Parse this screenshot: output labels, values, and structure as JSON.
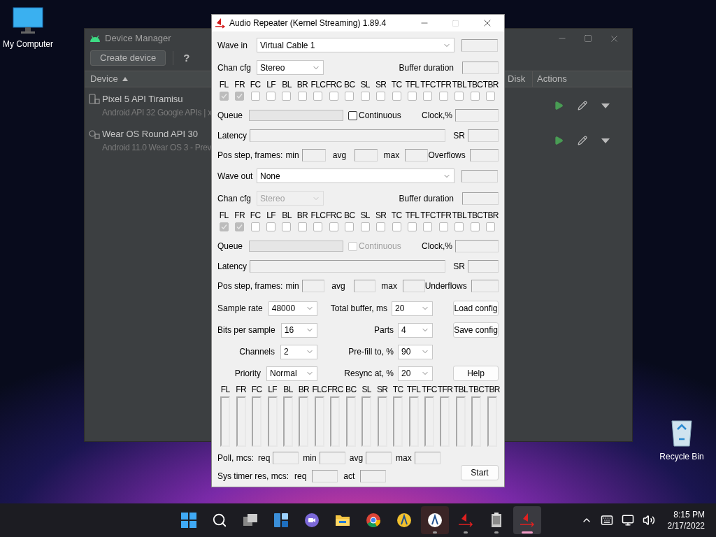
{
  "desktop_icons": [
    {
      "label": "My Computer"
    },
    {
      "label": "Recycle Bin"
    }
  ],
  "device_manager": {
    "title": "Device Manager",
    "create_button": "Create device",
    "help_button": "?",
    "columns": {
      "device": "Device",
      "disk": "Disk",
      "actions": "Actions"
    },
    "devices": [
      {
        "kind": "phone",
        "name": "Pixel 5 API Tiramisu",
        "details": "Android API 32 Google APIs | x"
      },
      {
        "kind": "watch",
        "name": "Wear OS Round API 30",
        "details": "Android 11.0 Wear OS 3 - Prev"
      }
    ]
  },
  "audio_repeater": {
    "title": "Audio Repeater (Kernel Streaming) 1.89.4",
    "sections": [
      {
        "wave_label": "Wave in",
        "device": "Virtual Cable 1",
        "chan_cfg_label": "Chan cfg",
        "chan_cfg": {
          "value": "Stereo",
          "disabled": false
        },
        "buffer_label": "Buffer duration",
        "channels": [
          {
            "label": "FL",
            "checked": true,
            "disabled": true
          },
          {
            "label": "FR",
            "checked": true,
            "disabled": true
          },
          {
            "label": "FC",
            "checked": false,
            "disabled": false
          },
          {
            "label": "LF",
            "checked": false,
            "disabled": false
          },
          {
            "label": "BL",
            "checked": false,
            "disabled": false
          },
          {
            "label": "BR",
            "checked": false,
            "disabled": false
          },
          {
            "label": "FLC",
            "checked": false,
            "disabled": false
          },
          {
            "label": "FRC",
            "checked": false,
            "disabled": false
          },
          {
            "label": "BC",
            "checked": false,
            "disabled": false
          },
          {
            "label": "SL",
            "checked": false,
            "disabled": false
          },
          {
            "label": "SR",
            "checked": false,
            "disabled": false
          },
          {
            "label": "TC",
            "checked": false,
            "disabled": false
          },
          {
            "label": "TFL",
            "checked": false,
            "disabled": false
          },
          {
            "label": "TFC",
            "checked": false,
            "disabled": false
          },
          {
            "label": "TFR",
            "checked": false,
            "disabled": false
          },
          {
            "label": "TBL",
            "checked": false,
            "disabled": false
          },
          {
            "label": "TBC",
            "checked": false,
            "disabled": false
          },
          {
            "label": "TBR",
            "checked": false,
            "disabled": false
          }
        ],
        "queue_label": "Queue",
        "continuous": {
          "label": "Continuous",
          "checked": false,
          "disabled": false
        },
        "clock_label": "Clock,%",
        "latency_label": "Latency",
        "sr_label": "SR",
        "pos_label": "Pos step, frames:",
        "min_label": "min",
        "avg_label": "avg",
        "max_label": "max",
        "flows_label": "Overflows"
      },
      {
        "wave_label": "Wave out",
        "device": "None",
        "chan_cfg_label": "Chan cfg",
        "chan_cfg": {
          "value": "Stereo",
          "disabled": true
        },
        "buffer_label": "Buffer duration",
        "channels": [
          {
            "label": "FL",
            "checked": true,
            "disabled": true
          },
          {
            "label": "FR",
            "checked": true,
            "disabled": true
          },
          {
            "label": "FC",
            "checked": false,
            "disabled": false
          },
          {
            "label": "LF",
            "checked": false,
            "disabled": false
          },
          {
            "label": "BL",
            "checked": false,
            "disabled": false
          },
          {
            "label": "BR",
            "checked": false,
            "disabled": false
          },
          {
            "label": "FLC",
            "checked": false,
            "disabled": false
          },
          {
            "label": "FRC",
            "checked": false,
            "disabled": false
          },
          {
            "label": "BC",
            "checked": false,
            "disabled": false
          },
          {
            "label": "SL",
            "checked": false,
            "disabled": false
          },
          {
            "label": "SR",
            "checked": false,
            "disabled": false
          },
          {
            "label": "TC",
            "checked": false,
            "disabled": false
          },
          {
            "label": "TFL",
            "checked": false,
            "disabled": false
          },
          {
            "label": "TFC",
            "checked": false,
            "disabled": false
          },
          {
            "label": "TFR",
            "checked": false,
            "disabled": false
          },
          {
            "label": "TBL",
            "checked": false,
            "disabled": false
          },
          {
            "label": "TBC",
            "checked": false,
            "disabled": false
          },
          {
            "label": "TBR",
            "checked": false,
            "disabled": false
          }
        ],
        "queue_label": "Queue",
        "continuous": {
          "label": "Continuous",
          "checked": false,
          "disabled": true
        },
        "clock_label": "Clock,%",
        "latency_label": "Latency",
        "sr_label": "SR",
        "pos_label": "Pos step, frames:",
        "min_label": "min",
        "avg_label": "avg",
        "max_label": "max",
        "flows_label": "Underflows"
      }
    ],
    "settings": [
      {
        "label": "Sample rate",
        "value": "48000",
        "label2": "Total buffer, ms",
        "value2": "20",
        "button": "Load config"
      },
      {
        "label": "Bits per sample",
        "value": "16",
        "label2": "Parts",
        "value2": "4",
        "button": "Save config"
      },
      {
        "label": "Channels",
        "value": "2",
        "label2": "Pre-fill to, %",
        "value2": "90"
      },
      {
        "label": "Priority",
        "value": "Normal",
        "label2": "Resync at, %",
        "value2": "20",
        "button": "Help"
      }
    ],
    "meter_labels": [
      "FL",
      "FR",
      "FC",
      "LF",
      "BL",
      "BR",
      "FLC",
      "FRC",
      "BC",
      "SL",
      "SR",
      "TC",
      "TFL",
      "TFC",
      "TFR",
      "TBL",
      "TBC",
      "TBR"
    ],
    "poll": {
      "label": "Poll, mcs:",
      "fields": [
        "req",
        "min",
        "avg",
        "max"
      ]
    },
    "sys_timer": {
      "label": "Sys timer res, mcs:",
      "fields": [
        "req",
        "act"
      ]
    },
    "start_button": "Start"
  },
  "taskbar": {
    "apps": [
      {
        "kind": "start",
        "running": false,
        "active": false
      },
      {
        "kind": "search",
        "running": false,
        "active": false
      },
      {
        "kind": "taskview",
        "running": false,
        "active": false
      },
      {
        "kind": "widgets",
        "running": false,
        "active": false
      },
      {
        "kind": "chat",
        "running": false,
        "active": false
      },
      {
        "kind": "folder",
        "running": false,
        "active": false
      },
      {
        "kind": "browser",
        "running": false,
        "active": false
      },
      {
        "kind": "studio-yellow",
        "running": false,
        "active": false
      },
      {
        "kind": "studio",
        "running": true,
        "active": false
      },
      {
        "kind": "repeater",
        "running": true,
        "active": false
      },
      {
        "kind": "archive",
        "running": true,
        "active": false
      },
      {
        "kind": "repeater",
        "running": true,
        "active": true
      }
    ],
    "time": "8:15 PM",
    "date": "2/17/2022"
  }
}
